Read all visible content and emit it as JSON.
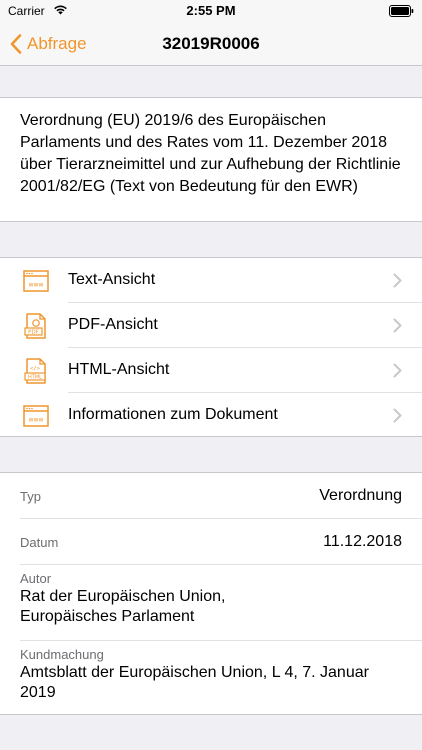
{
  "status": {
    "carrier": "Carrier",
    "time": "2:55 PM"
  },
  "nav": {
    "back_label": "Abfrage",
    "title": "32019R0006"
  },
  "document": {
    "title": "Verordnung (EU) 2019/6 des Europäischen Parlaments und des Rates vom 11. Dezember 2018 über Tierarzneimittel und zur Aufhebung der Richtlinie 2001/82/EG (Text von Bedeutung für den EWR)"
  },
  "links": [
    {
      "label": "Text-Ansicht",
      "icon": "www-page-icon"
    },
    {
      "label": "PDF-Ansicht",
      "icon": "pdf-file-icon"
    },
    {
      "label": "HTML-Ansicht",
      "icon": "html-file-icon"
    },
    {
      "label": "Informationen zum Dokument",
      "icon": "www-page-icon"
    }
  ],
  "info": {
    "typ_label": "Typ",
    "typ_value": "Verordnung",
    "datum_label": "Datum",
    "datum_value": "11.12.2018",
    "autor_label": "Autor",
    "autor_value": "Rat der Europäischen Union, Europäisches Parlament",
    "kundmachung_label": "Kundmachung",
    "kundmachung_value": "Amtsblatt der Europäischen Union, L 4, 7. Januar 2019"
  },
  "colors": {
    "accent": "#f0962e",
    "background": "#efeff4",
    "secondary_text": "#6d6d72"
  }
}
